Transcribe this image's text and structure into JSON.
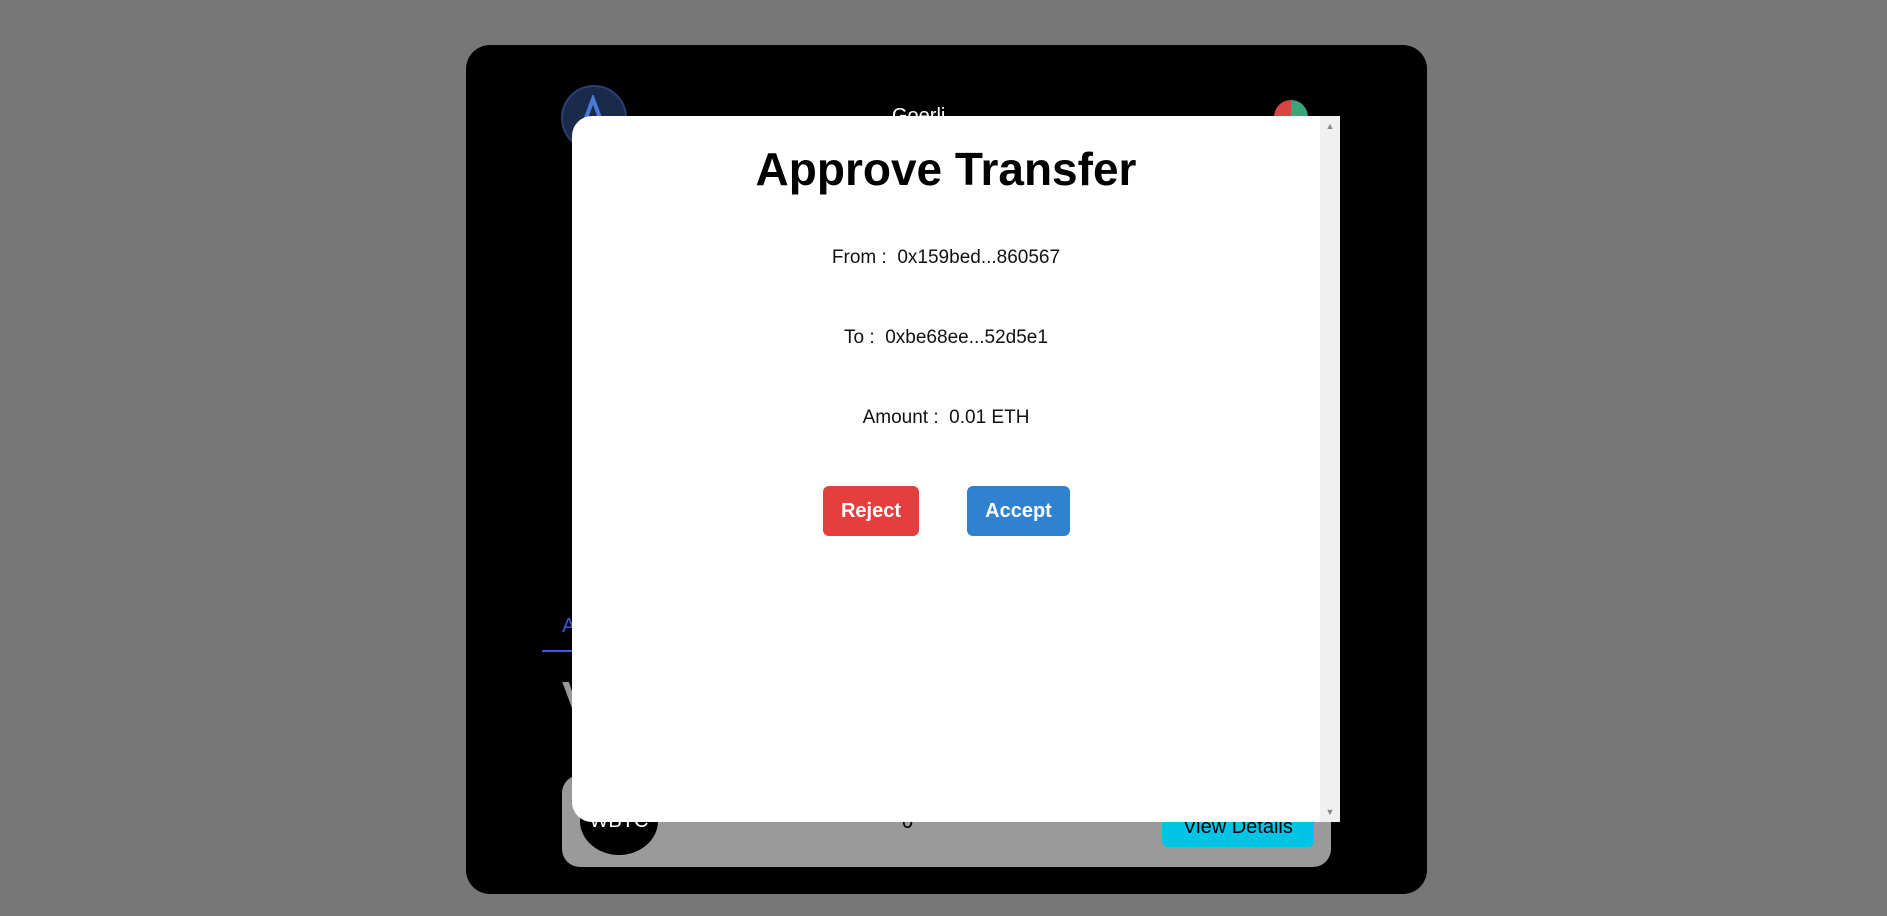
{
  "background_app": {
    "network": "Goerli",
    "tab_label": "A",
    "section_title": "V",
    "token": {
      "symbol": "WBTC",
      "balance": "0",
      "view_details_label": "View Details"
    }
  },
  "modal": {
    "title": "Approve Transfer",
    "from_label": "From :",
    "from_value": "0x159bed...860567",
    "to_label": "To :",
    "to_value": "0xbe68ee...52d5e1",
    "amount_label": "Amount :",
    "amount_value": "0.01 ETH",
    "reject_label": "Reject",
    "accept_label": "Accept"
  },
  "colors": {
    "overlay": "#777777",
    "reject": "#e53e3e",
    "accept": "#3182ce",
    "accent_blue": "#3a5ad8",
    "view_details": "#00c4e6"
  },
  "icons": {
    "logo": "app-logo-icon",
    "network_dropdown": "chevron-down-icon",
    "account": "account-avatar-icon",
    "scroll_up": "scroll-up-arrow-icon",
    "scroll_down": "scroll-down-arrow-icon"
  }
}
